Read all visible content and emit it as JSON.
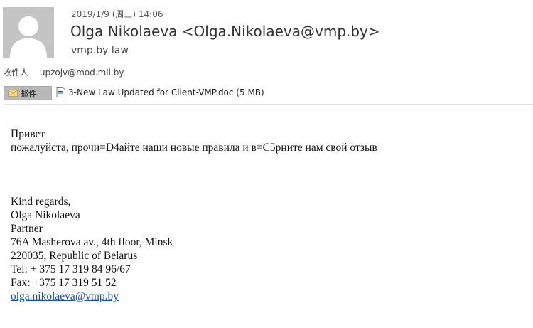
{
  "header": {
    "date": "2019/1/9 (周三) 14:06",
    "sender": "Olga Nikolaeva <Olga.Nikolaeva@vmp.by>",
    "company": "vmp.by law",
    "to_label": "收件人",
    "to_address": "upzojv@mod.mil.by"
  },
  "attachments": {
    "mail_label": "邮件",
    "file": "3-New Law Updated for Client-VMP.doc (5 MB)"
  },
  "body": {
    "greeting": "Привет",
    "message": "пожалуйста, прочи=D4айте наши новые правила и в=C5рните нам свой отзыв",
    "signature": {
      "closing": "Kind regards,",
      "name": "Olga Nikolaeva",
      "title": "Partner",
      "address1": "76A Masherova av., 4th floor, Minsk",
      "address2": "220035, Republic of Belarus",
      "tel": "Tel:  + 375 17 319 84 96/67",
      "fax": "Fax: +375 17 319 51 52",
      "email": "olga.nikolaeva@vmp.by"
    }
  }
}
